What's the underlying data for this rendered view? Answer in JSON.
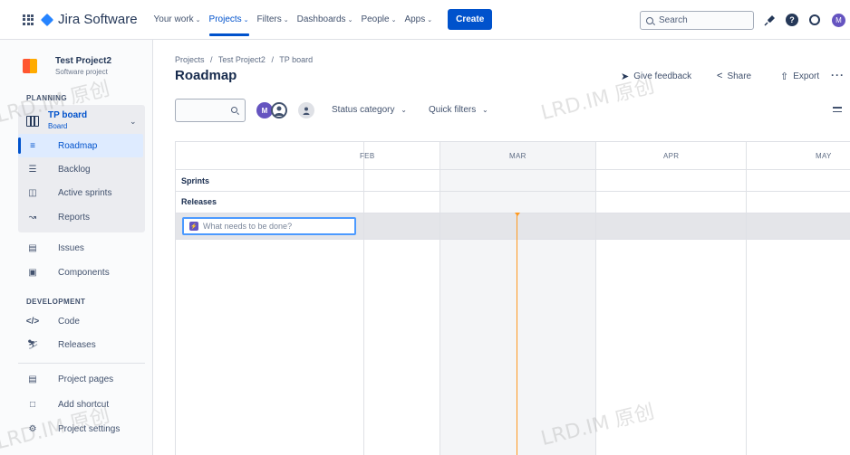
{
  "app": {
    "product_name": "Jira Software",
    "nav_items": [
      {
        "label": "Your work",
        "active": false
      },
      {
        "label": "Projects",
        "active": true
      },
      {
        "label": "Filters",
        "active": false
      },
      {
        "label": "Dashboards",
        "active": false
      },
      {
        "label": "People",
        "active": false
      },
      {
        "label": "Apps",
        "active": false
      }
    ],
    "create_label": "Create",
    "search_placeholder": "Search",
    "user_initial": "M",
    "accent_color": "#0052cc"
  },
  "sidebar": {
    "project_name": "Test Project2",
    "project_type": "Software project",
    "planning_label": "PLANNING",
    "board_name": "TP board",
    "board_type": "Board",
    "planning_items": [
      {
        "label": "Roadmap",
        "icon": "roadmap-icon",
        "selected": true
      },
      {
        "label": "Backlog",
        "icon": "backlog-icon",
        "selected": false
      },
      {
        "label": "Active sprints",
        "icon": "board-columns-icon",
        "selected": false
      },
      {
        "label": "Reports",
        "icon": "chart-line-icon",
        "selected": false
      }
    ],
    "other_items": [
      {
        "label": "Issues",
        "icon": "issues-icon"
      },
      {
        "label": "Components",
        "icon": "components-icon"
      }
    ],
    "development_label": "DEVELOPMENT",
    "development_items": [
      {
        "label": "Code",
        "icon": "code-icon"
      },
      {
        "label": "Releases",
        "icon": "ship-icon"
      }
    ],
    "bottom_items": [
      {
        "label": "Project pages",
        "icon": "page-icon"
      },
      {
        "label": "Add shortcut",
        "icon": "add-shortcut-icon"
      },
      {
        "label": "Project settings",
        "icon": "gear-icon"
      }
    ]
  },
  "main": {
    "breadcrumb": [
      "Projects",
      "Test Project2",
      "TP board"
    ],
    "breadcrumb_sep": "/",
    "title": "Roadmap",
    "give_feedback": "Give feedback",
    "share": "Share",
    "export": "Export",
    "avatar_initial": "M",
    "status_category": "Status category",
    "quick_filters": "Quick filters"
  },
  "roadmap": {
    "months": [
      "FEB",
      "MAR",
      "APR",
      "MAY"
    ],
    "rows": [
      "Sprints",
      "Releases"
    ],
    "new_issue_placeholder": "What needs to be done?"
  },
  "watermark": "LRD.IM 原创"
}
